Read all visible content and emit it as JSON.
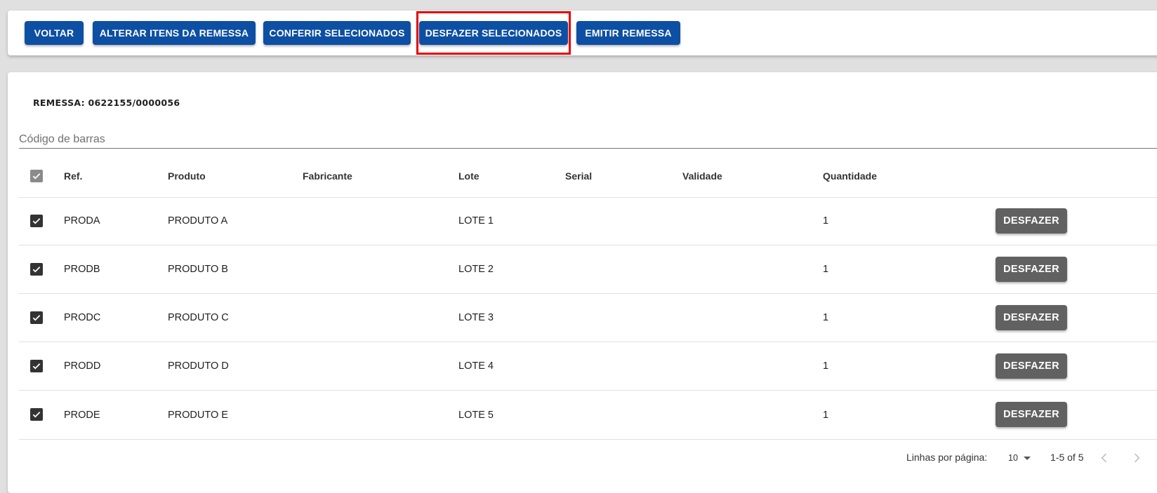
{
  "toolbar": {
    "voltar": "VOLTAR",
    "alterar": "ALTERAR ITENS DA REMESSA",
    "conferir": "CONFERIR SELECIONADOS",
    "desfazer_sel": "DESFAZER SELECIONADOS",
    "emitir": "EMITIR REMESSA"
  },
  "remessa_label": "REMESSA: 0622155/0000056",
  "barcode": {
    "placeholder": "Código de barras",
    "value": ""
  },
  "table": {
    "headers": {
      "ref": "Ref.",
      "produto": "Produto",
      "fabricante": "Fabricante",
      "lote": "Lote",
      "serial": "Serial",
      "validade": "Validade",
      "quantidade": "Quantidade"
    },
    "select_all_state": "indeterminate",
    "rows": [
      {
        "checked": true,
        "ref": "PRODA",
        "produto": "PRODUTO A",
        "fabricante": "",
        "lote": "LOTE 1",
        "serial": "",
        "validade": "",
        "quantidade": "1",
        "action": "DESFAZER"
      },
      {
        "checked": true,
        "ref": "PRODB",
        "produto": "PRODUTO B",
        "fabricante": "",
        "lote": "LOTE 2",
        "serial": "",
        "validade": "",
        "quantidade": "1",
        "action": "DESFAZER"
      },
      {
        "checked": true,
        "ref": "PRODC",
        "produto": "PRODUTO C",
        "fabricante": "",
        "lote": "LOTE 3",
        "serial": "",
        "validade": "",
        "quantidade": "1",
        "action": "DESFAZER"
      },
      {
        "checked": true,
        "ref": "PRODD",
        "produto": "PRODUTO D",
        "fabricante": "",
        "lote": "LOTE 4",
        "serial": "",
        "validade": "",
        "quantidade": "1",
        "action": "DESFAZER"
      },
      {
        "checked": true,
        "ref": "PRODE",
        "produto": "PRODUTO E",
        "fabricante": "",
        "lote": "LOTE 5",
        "serial": "",
        "validade": "",
        "quantidade": "1",
        "action": "DESFAZER"
      }
    ]
  },
  "pagination": {
    "rows_per_page_label": "Linhas por página:",
    "rows_per_page_value": "10",
    "range_text": "1-5 of 5"
  },
  "colors": {
    "primary": "#0d4fa3",
    "secondary_button": "#616161",
    "highlight": "#e60000",
    "checkbox": "#333333"
  },
  "icons": [
    "checkbox-checked-icon",
    "checkbox-indeterminate-icon",
    "chevron-left-icon",
    "chevron-right-icon",
    "dropdown-caret-icon"
  ]
}
